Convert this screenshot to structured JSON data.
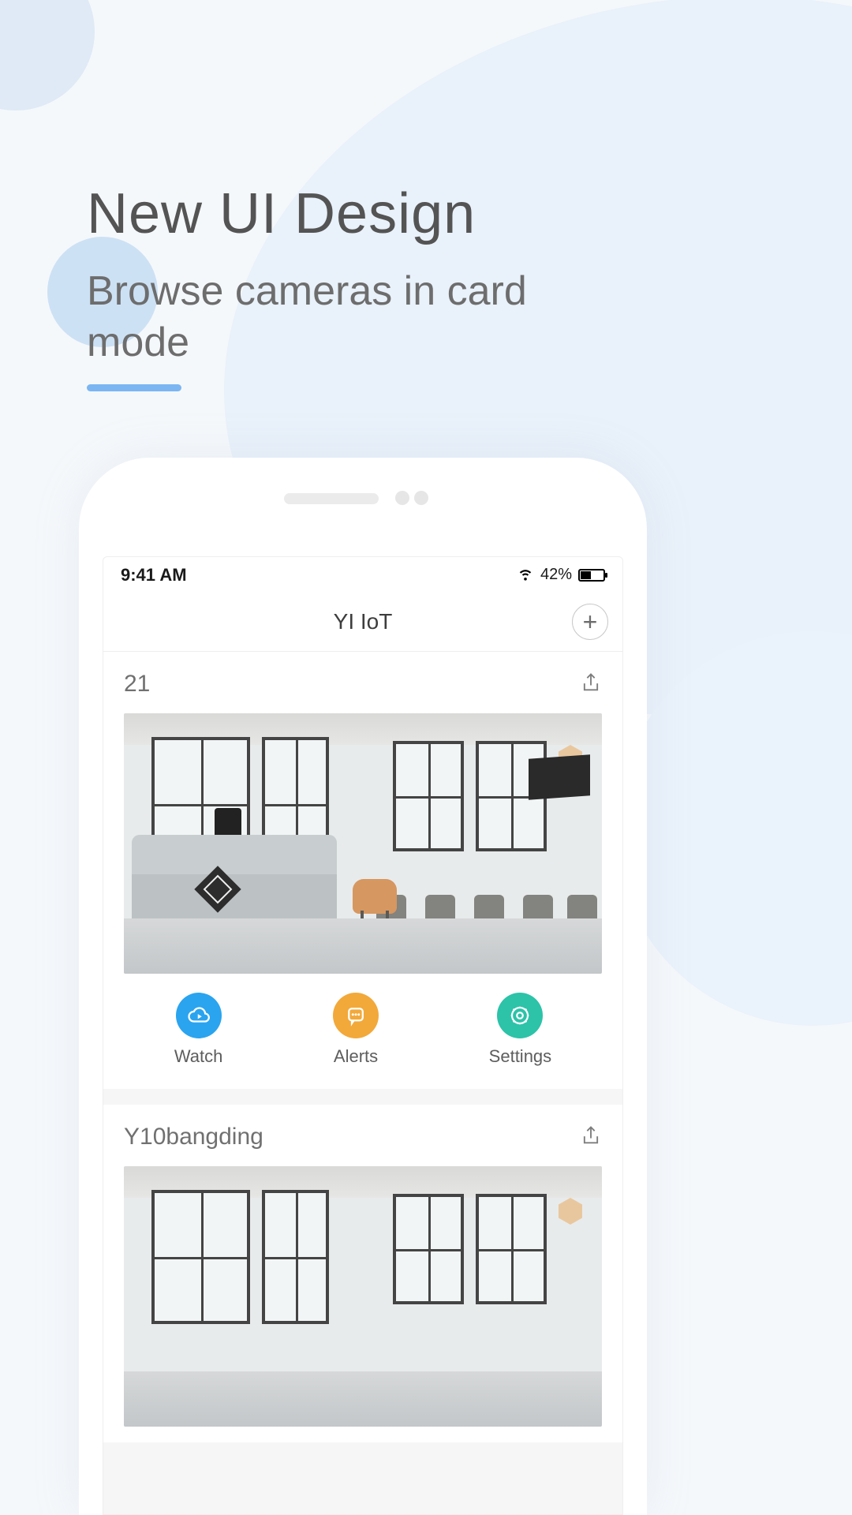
{
  "promo": {
    "title": "New UI Design",
    "subtitle": "Browse cameras in card mode"
  },
  "statusbar": {
    "time": "9:41 AM",
    "battery_pct": "42%"
  },
  "app": {
    "title": "YI IoT",
    "add_glyph": "+"
  },
  "cards": [
    {
      "title": "21"
    },
    {
      "title": "Y10bangding"
    }
  ],
  "actions": {
    "watch": "Watch",
    "alerts": "Alerts",
    "settings": "Settings"
  }
}
